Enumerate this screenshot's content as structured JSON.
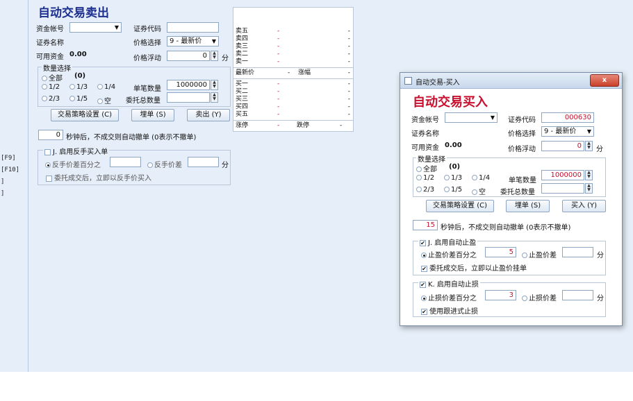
{
  "left_strip": {
    "items": [
      "[F9]",
      "[F10]",
      "]",
      "]"
    ]
  },
  "sell": {
    "title": "自动交易卖出",
    "account_label": "资金帐号",
    "account_value": "",
    "code_label": "证券代码",
    "code_value": "",
    "name_label": "证券名称",
    "price_select_label": "价格选择",
    "price_select_value": "9 - 最新价",
    "funds_label": "可用资金",
    "funds_value": "0.00",
    "float_label": "价格浮动",
    "float_value": "0",
    "float_unit": "分",
    "qty_group_title": "数量选择",
    "qty_all": "全部",
    "qty_all_value": "(0)",
    "qty_options_row1": [
      "1/2",
      "1/3",
      "1/4"
    ],
    "qty_options_row2": [
      "2/3",
      "1/5",
      "空"
    ],
    "single_qty_label": "单笔数量",
    "single_qty_value": "1000000",
    "total_qty_label": "委托总数量",
    "total_qty_value": "",
    "btn_strategy": "交易策略设置 (C)",
    "btn_pending": "埋单 (S)",
    "btn_sell": "卖出 (Y)",
    "cancel_seconds": "0",
    "cancel_text": "秒钟后，不成交则自动撤单 (0表示不撤单)",
    "reverse_title": "J. 启用反手买入单",
    "reverse_pct_label": "反手价差百分之",
    "reverse_pct_value": "",
    "reverse_diff_label": "反手价差",
    "reverse_diff_value": "",
    "reverse_unit": "分",
    "reverse_after": "委托成交后，立即以反手价买入"
  },
  "quote": {
    "asks": [
      {
        "name": "卖五",
        "price": "-",
        "vol": "-"
      },
      {
        "name": "卖四",
        "price": "-",
        "vol": "-"
      },
      {
        "name": "卖三",
        "price": "-",
        "vol": "-"
      },
      {
        "name": "卖二",
        "price": "-",
        "vol": "-"
      },
      {
        "name": "卖一",
        "price": "-",
        "vol": "-"
      }
    ],
    "last_label": "最新价",
    "last_value": "-",
    "change_label": "涨幅",
    "change_value": "-",
    "bids": [
      {
        "name": "买一",
        "price": "-",
        "vol": "-"
      },
      {
        "name": "买二",
        "price": "-",
        "vol": "-"
      },
      {
        "name": "买三",
        "price": "-",
        "vol": "-"
      },
      {
        "name": "买四",
        "price": "-",
        "vol": "-"
      },
      {
        "name": "买五",
        "price": "-",
        "vol": "-"
      }
    ],
    "limit_up_label": "涨停",
    "limit_up_value": "-",
    "limit_down_label": "跌停",
    "limit_down_value": "-"
  },
  "buy": {
    "window_title": "自动交易-买入",
    "close_label": "x",
    "title": "自动交易买入",
    "account_label": "资金帐号",
    "account_value": "",
    "code_label": "证券代码",
    "code_value": "000630",
    "name_label": "证券名称",
    "price_select_label": "价格选择",
    "price_select_value": "9 - 最新价",
    "funds_label": "可用资金",
    "funds_value": "0.00",
    "float_label": "价格浮动",
    "float_value": "0",
    "float_unit": "分",
    "qty_group_title": "数量选择",
    "qty_all": "全部",
    "qty_all_value": "(0)",
    "qty_options_row1": [
      "1/2",
      "1/3",
      "1/4"
    ],
    "qty_options_row2": [
      "2/3",
      "1/5",
      "空"
    ],
    "single_qty_label": "单笔数量",
    "single_qty_value": "1000000",
    "total_qty_label": "委托总数量",
    "total_qty_value": "",
    "btn_strategy": "交易策略设置 (C)",
    "btn_pending": "埋单 (S)",
    "btn_buy": "买入 (Y)",
    "cancel_seconds": "15",
    "cancel_text": "秒钟后，不成交则自动撤单 (0表示不撤单)",
    "tp_title": "J. 启用自动止盈",
    "tp_pct_label": "止盈价差百分之",
    "tp_pct_value": "5",
    "tp_diff_label": "止盈价差",
    "tp_diff_value": "",
    "tp_unit": "分",
    "tp_after": "委托成交后，立即以止盈价挂单",
    "sl_title": "K. 启用自动止损",
    "sl_pct_label": "止损价差百分之",
    "sl_pct_value": "3",
    "sl_diff_label": "止损价差",
    "sl_diff_value": "",
    "sl_unit": "分",
    "sl_trailing": "使用跟进式止损"
  }
}
